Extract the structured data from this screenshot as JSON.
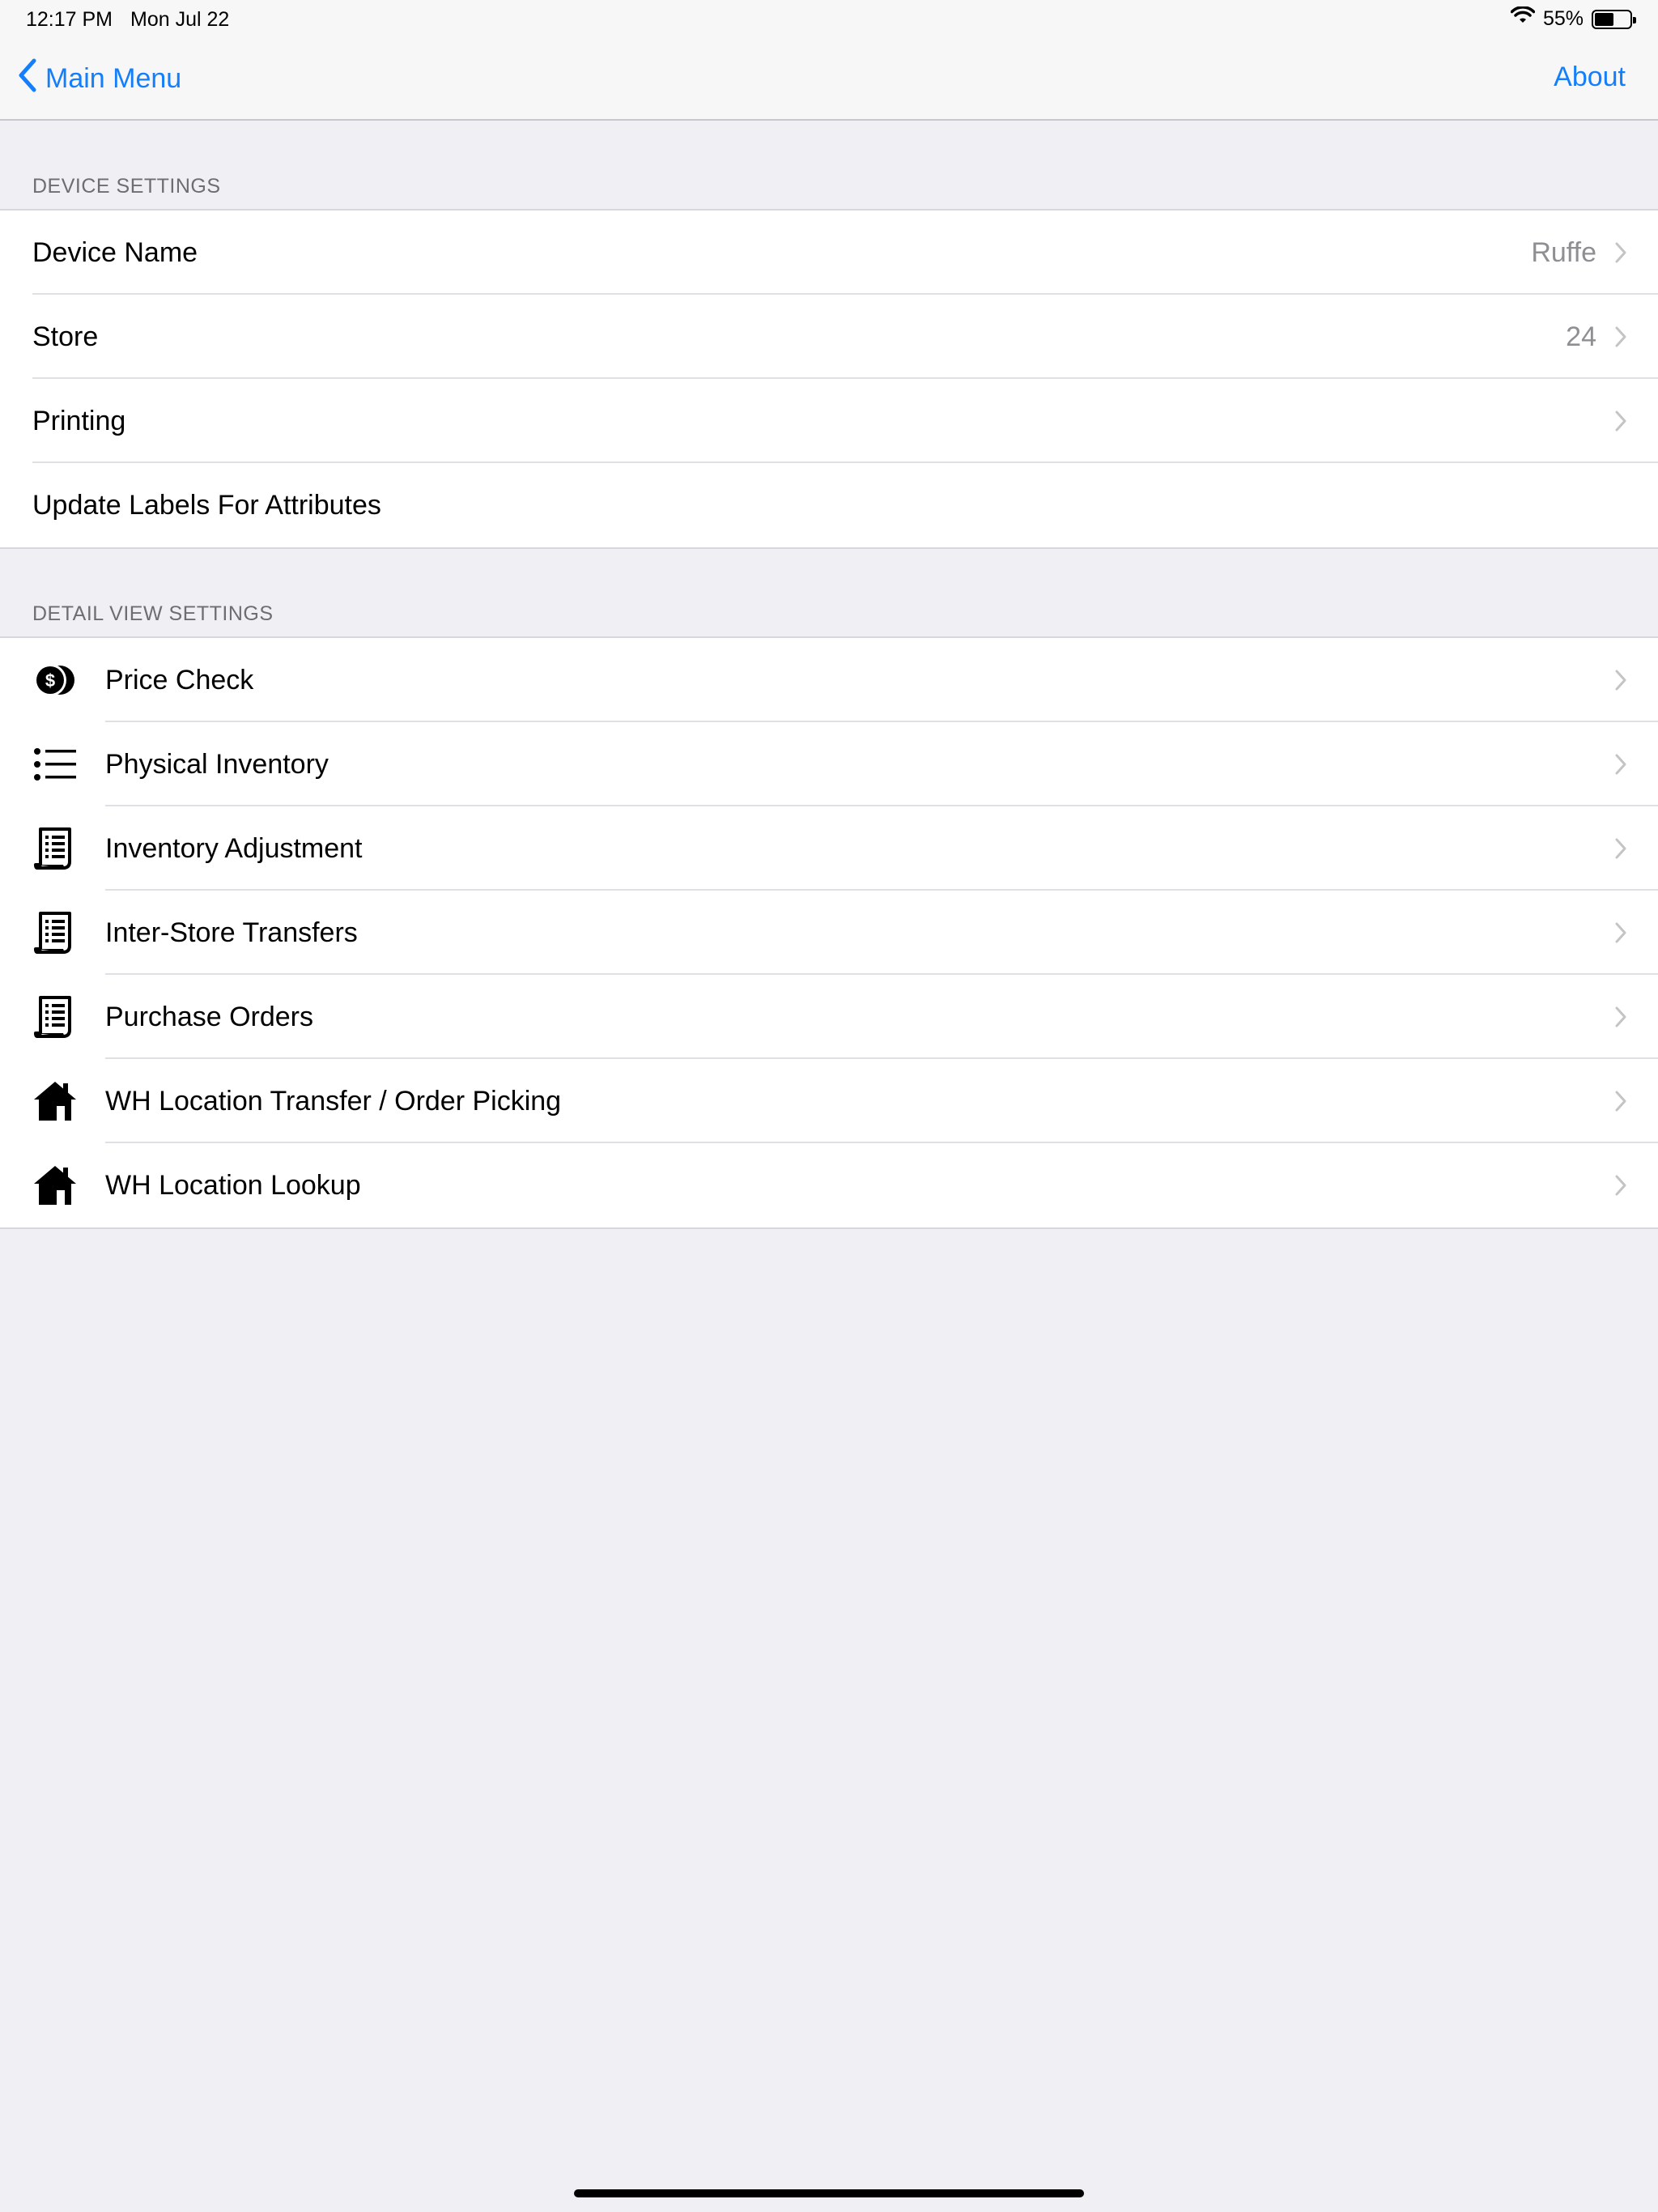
{
  "status_bar": {
    "time": "12:17 PM",
    "date": "Mon Jul 22",
    "battery": "55%",
    "battery_level": 0.55
  },
  "nav": {
    "back_label": "Main Menu",
    "right_label": "About"
  },
  "device_settings": {
    "header": "DEVICE SETTINGS",
    "rows": [
      {
        "label": "Device Name",
        "value": "Ruffe"
      },
      {
        "label": "Store",
        "value": "24"
      },
      {
        "label": "Printing",
        "value": ""
      },
      {
        "label": "Update Labels For Attributes",
        "value": ""
      }
    ]
  },
  "detail_view_settings": {
    "header": "DETAIL VIEW SETTINGS",
    "rows": [
      {
        "label": "Price Check",
        "icon": "coins-icon"
      },
      {
        "label": "Physical Inventory",
        "icon": "list-icon"
      },
      {
        "label": "Inventory Adjustment",
        "icon": "receipt-icon"
      },
      {
        "label": "Inter-Store Transfers",
        "icon": "receipt-icon"
      },
      {
        "label": "Purchase Orders",
        "icon": "receipt-icon"
      },
      {
        "label": "WH Location Transfer / Order Picking",
        "icon": "house-icon"
      },
      {
        "label": "WH Location Lookup",
        "icon": "house-icon"
      }
    ]
  },
  "colors": {
    "accent": "#147efb",
    "background": "#efeff4",
    "secondary_text": "#8e8e93"
  }
}
